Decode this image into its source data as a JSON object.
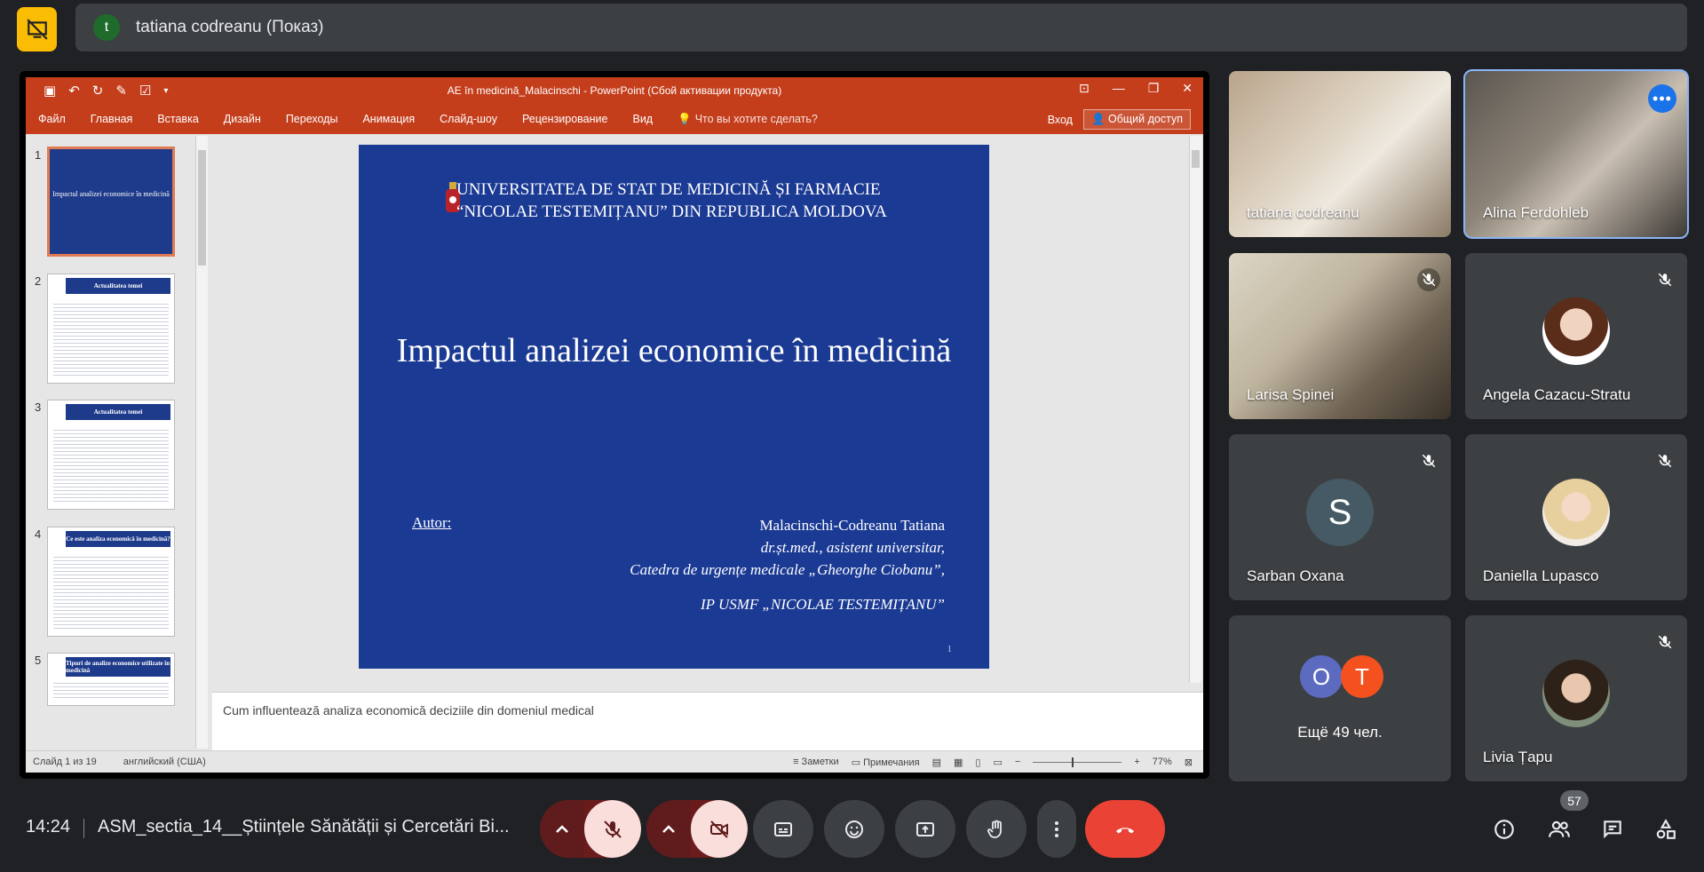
{
  "presenter": {
    "avatar_letter": "t",
    "name": "tatiana codreanu (Показ)"
  },
  "ppt": {
    "doc_title": "AE în medicină_Malacinschi - PowerPoint (Сбой активации продукта)",
    "menu": [
      "Файл",
      "Главная",
      "Вставка",
      "Дизайн",
      "Переходы",
      "Анимация",
      "Слайд-шоу",
      "Рецензирование",
      "Вид"
    ],
    "tell_me": "Что вы хотите сделать?",
    "signin": "Вход",
    "share": "Общий доступ",
    "thumbs": [
      {
        "num": "1",
        "title": "Impactul analizei economice în medicină"
      },
      {
        "num": "2",
        "title": "Actualitatea temei"
      },
      {
        "num": "3",
        "title": "Actualitatea temei"
      },
      {
        "num": "4",
        "title": "Ce este analiza economică în medicină?"
      },
      {
        "num": "5",
        "title": "Tipuri de analize economice utilizate în medicină"
      }
    ],
    "slide": {
      "university_line1": "UNIVERSITATEA DE STAT DE MEDICINĂ ȘI FARMACIE",
      "university_line2": "“NICOLAE TESTEMIȚANU” DIN REPUBLICA MOLDOVA",
      "title": "Impactul analizei economice în medicină",
      "author_label": "Autor:",
      "author_name": "Malacinschi-Codreanu Tatiana",
      "author_degree": "dr.șt.med., asistent universitar,",
      "author_dept": "Catedra de urgențe medicale „Gheorghe Ciobanu”,",
      "author_inst": "IP USMF „NICOLAE TESTEMIȚANU”",
      "slide_number": "1"
    },
    "notes": "Cum influentează analiza economică deciziile din domeniul medical",
    "status": {
      "slide_of": "Слайд 1 из 19",
      "language": "английский (США)",
      "notes_btn": "Заметки",
      "comments_btn": "Примечания",
      "zoom": "77%"
    }
  },
  "participants": [
    {
      "name": "tatiana codreanu",
      "type": "video",
      "muted": false
    },
    {
      "name": "Alina Ferdohleb",
      "type": "video",
      "muted": false,
      "active": true
    },
    {
      "name": "Larisa Spinei",
      "type": "video",
      "muted": true
    },
    {
      "name": "Angela Cazacu-Stratu",
      "type": "photo",
      "muted": true
    },
    {
      "name": "Sarban Oxana",
      "type": "letter",
      "letter": "S",
      "muted": true
    },
    {
      "name": "Daniella Lupasco",
      "type": "photo",
      "muted": true
    },
    {
      "name": "Ещё 49 чел.",
      "type": "group",
      "letters": [
        "O",
        "T"
      ]
    },
    {
      "name": "Livia Țapu",
      "type": "photo",
      "muted": true
    }
  ],
  "bottom": {
    "time": "14:24",
    "meeting": "ASM_sectia_14__Științele Sănătății și Cercetări Bi...",
    "people_count": "57"
  },
  "colors": {
    "accent": "#8ab4f8",
    "end_call": "#ea4335",
    "ppt_red": "#c43e1c",
    "slide_blue": "#1b3a94"
  }
}
